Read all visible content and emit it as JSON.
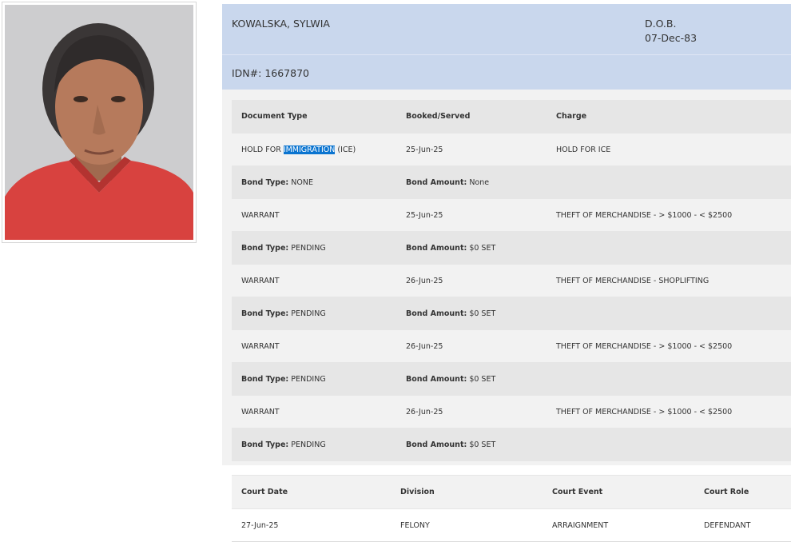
{
  "person": {
    "name": "KOWALSKA, SYLWIA",
    "dob_label": "D.O.B.",
    "dob": "07-Dec-83",
    "idn": "IDN#: 1667870"
  },
  "documents": {
    "headers": [
      "Document Type",
      "Booked/Served",
      "Charge"
    ],
    "first_row": {
      "type_prefix": "HOLD FOR ",
      "type_highlight": "IMMIGRATION",
      "type_suffix": " (ICE)",
      "date": "25-Jun-25",
      "charge": "HOLD FOR ICE"
    },
    "bond_type_label": "Bond Type:",
    "bond_amount_label": "Bond Amount:",
    "first_bond": {
      "type": "NONE",
      "amount": "None"
    },
    "rows": [
      {
        "type": "WARRANT",
        "date": "25-Jun-25",
        "charge": "THEFT OF MERCHANDISE - > $1000 - < $2500",
        "bond_type": "PENDING",
        "bond_amount": "$0 SET"
      },
      {
        "type": "WARRANT",
        "date": "26-Jun-25",
        "charge": "THEFT OF MERCHANDISE - SHOPLIFTING",
        "bond_type": "PENDING",
        "bond_amount": "$0 SET"
      },
      {
        "type": "WARRANT",
        "date": "26-Jun-25",
        "charge": "THEFT OF MERCHANDISE - > $1000 - < $2500",
        "bond_type": "PENDING",
        "bond_amount": "$0 SET"
      },
      {
        "type": "WARRANT",
        "date": "26-Jun-25",
        "charge": "THEFT OF MERCHANDISE - > $1000 - < $2500",
        "bond_type": "PENDING",
        "bond_amount": "$0 SET"
      }
    ]
  },
  "court": {
    "headers": [
      "Court Date",
      "Division",
      "Court Event",
      "Court Role"
    ],
    "rows": [
      {
        "date": "27-Jun-25",
        "division": "FELONY",
        "event": "ARRAIGNMENT",
        "role": "DEFENDANT"
      }
    ]
  },
  "colors": {
    "header_bg": "#c9d7ed",
    "row_light": "#f2f2f2",
    "row_dark": "#e6e6e6",
    "selection": "#0a74d0"
  }
}
